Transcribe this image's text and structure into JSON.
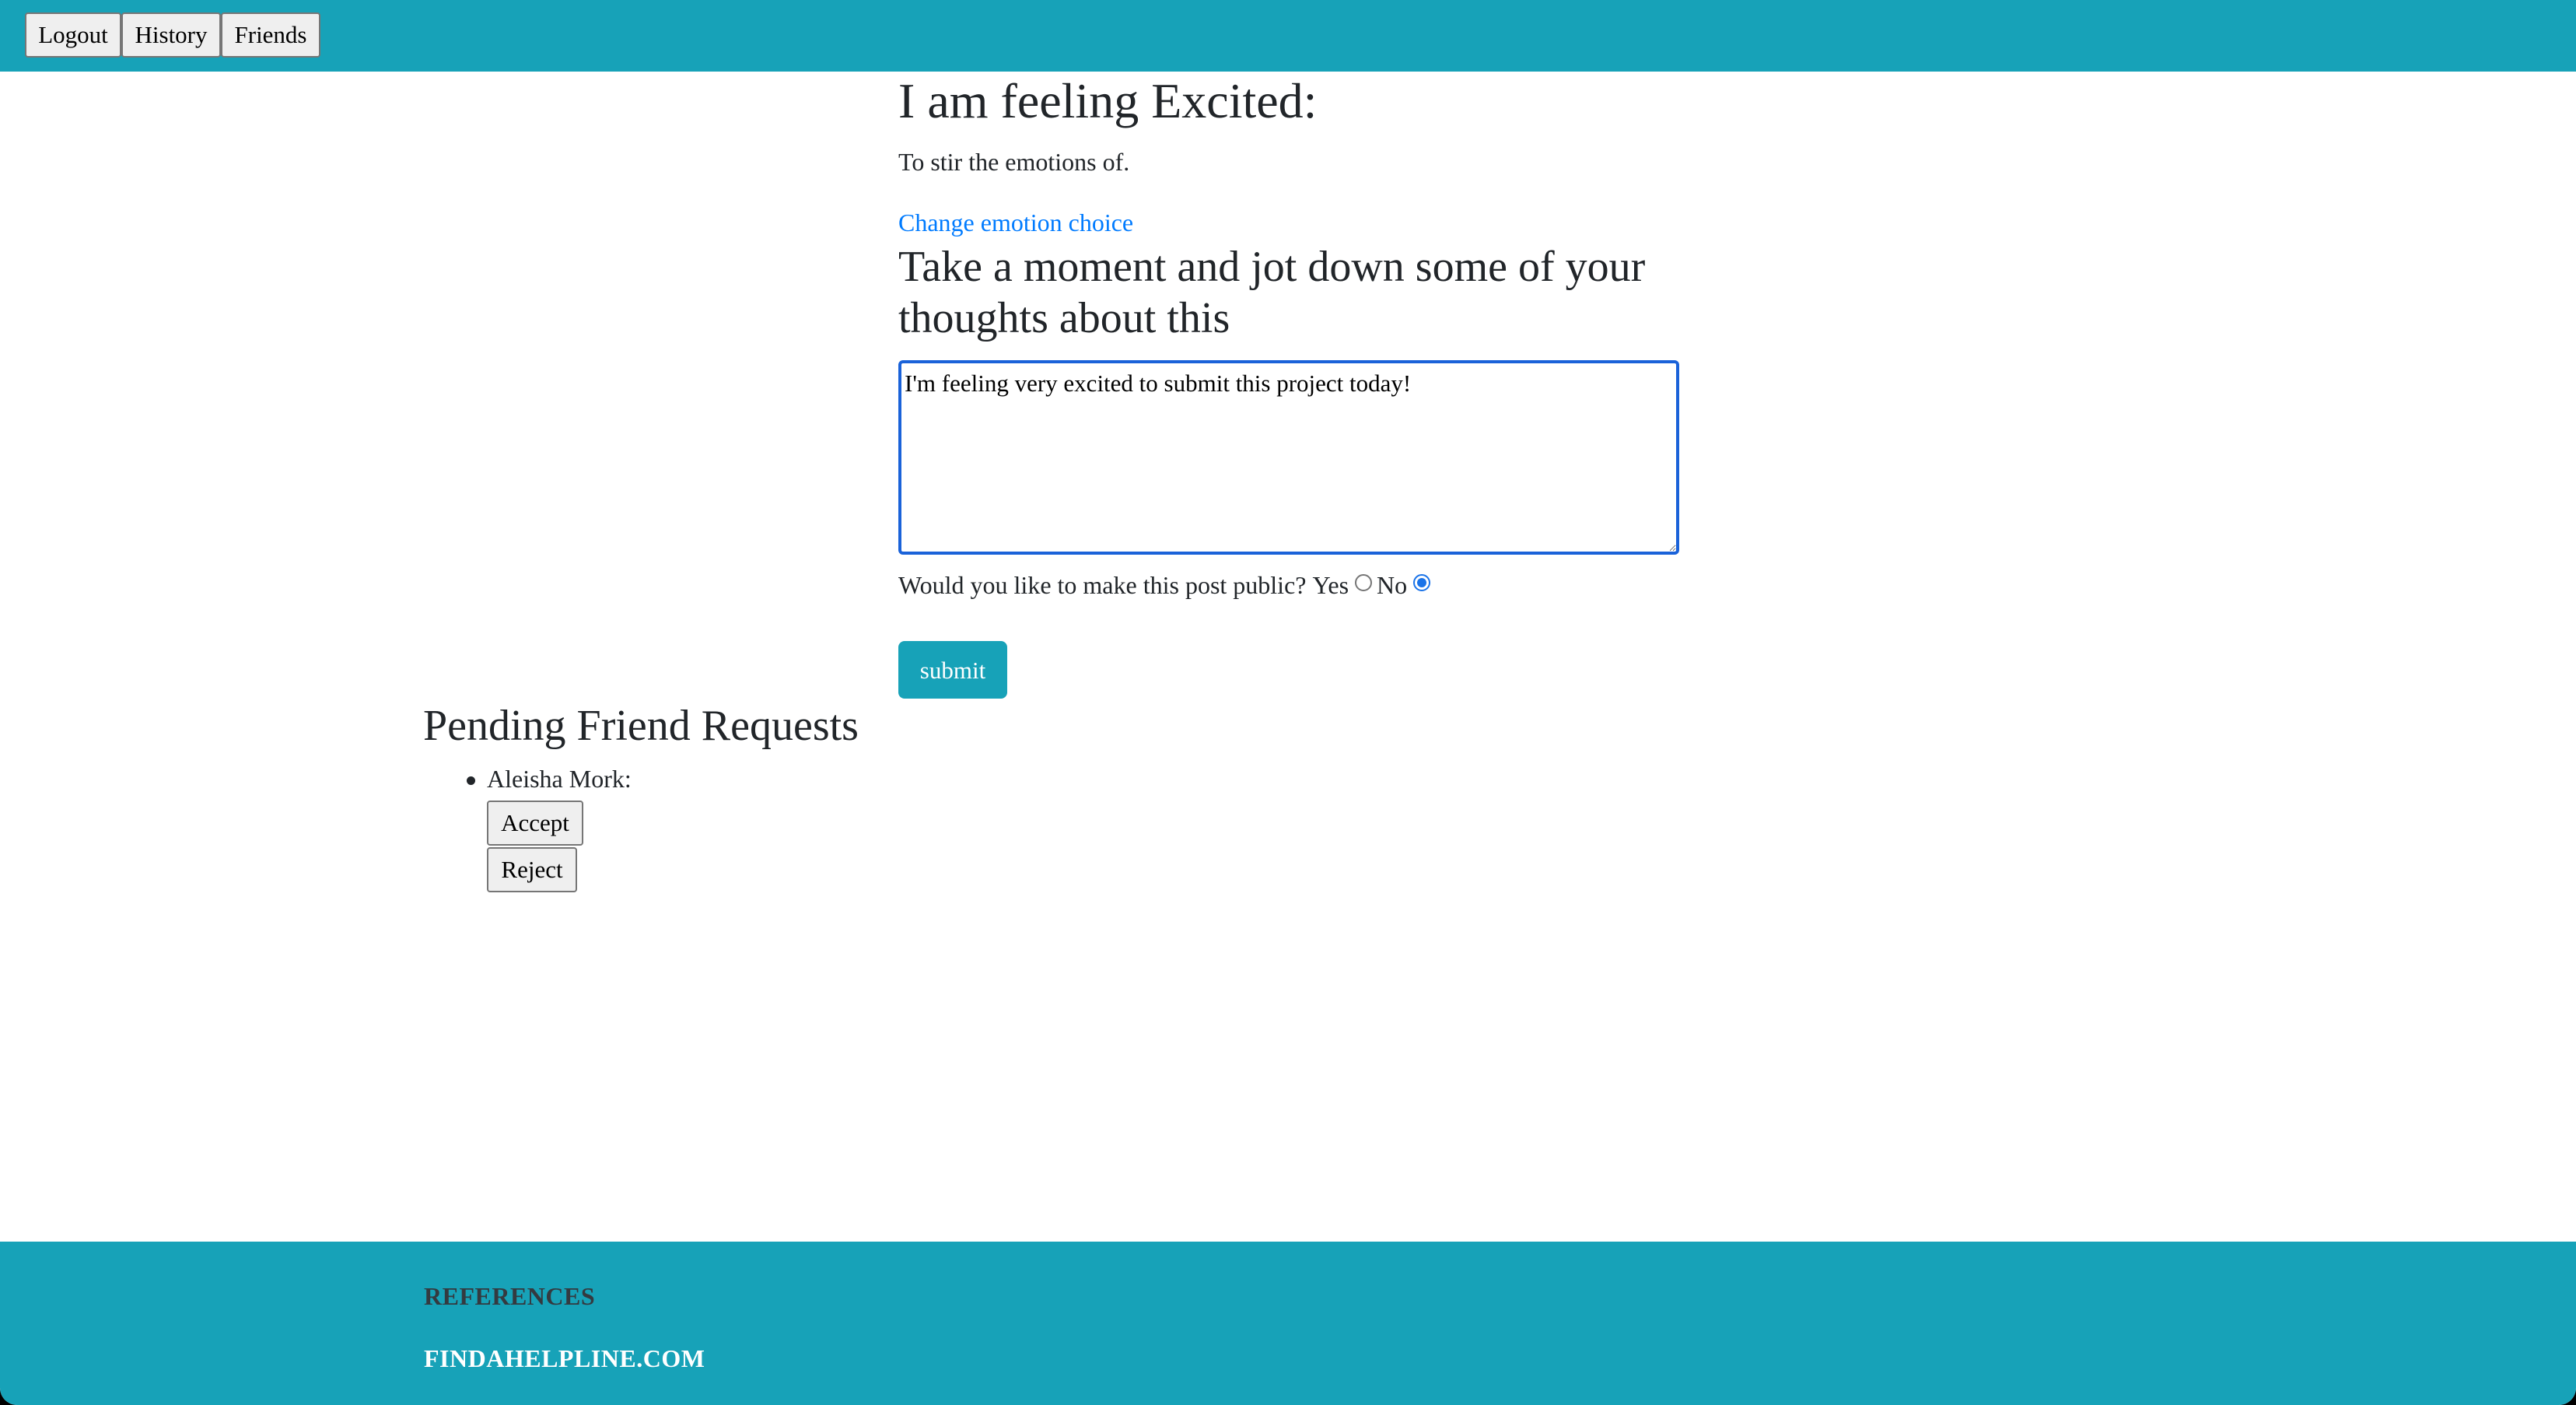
{
  "nav": {
    "logout": "Logout",
    "history": "History",
    "friends": "Friends"
  },
  "main": {
    "heading": "I am feeling Excited:",
    "definition": "To stir the emotions of.",
    "change_link": "Change emotion choice",
    "prompt": "Take a moment and jot down some of your thoughts about this",
    "thoughts_value": "I'm feeling very excited to submit this project today!",
    "public_question": "Would you like to make this post public?",
    "yes_label": "Yes",
    "no_label": "No",
    "public_selected": "No",
    "submit_label": "submit"
  },
  "pending": {
    "title": "Pending Friend Requests",
    "requests": [
      {
        "name": "Aleisha Mork:",
        "accept_label": "Accept",
        "reject_label": "Reject"
      }
    ]
  },
  "footer": {
    "references_title": "REFERENCES",
    "link_text": "FINDAHELPLINE.COM"
  },
  "colors": {
    "navbar": "#17a2b8",
    "footer": "#17a2b8",
    "link": "#007bff",
    "focus_border": "#1a62d9",
    "submit_button": "#17a2b8"
  }
}
